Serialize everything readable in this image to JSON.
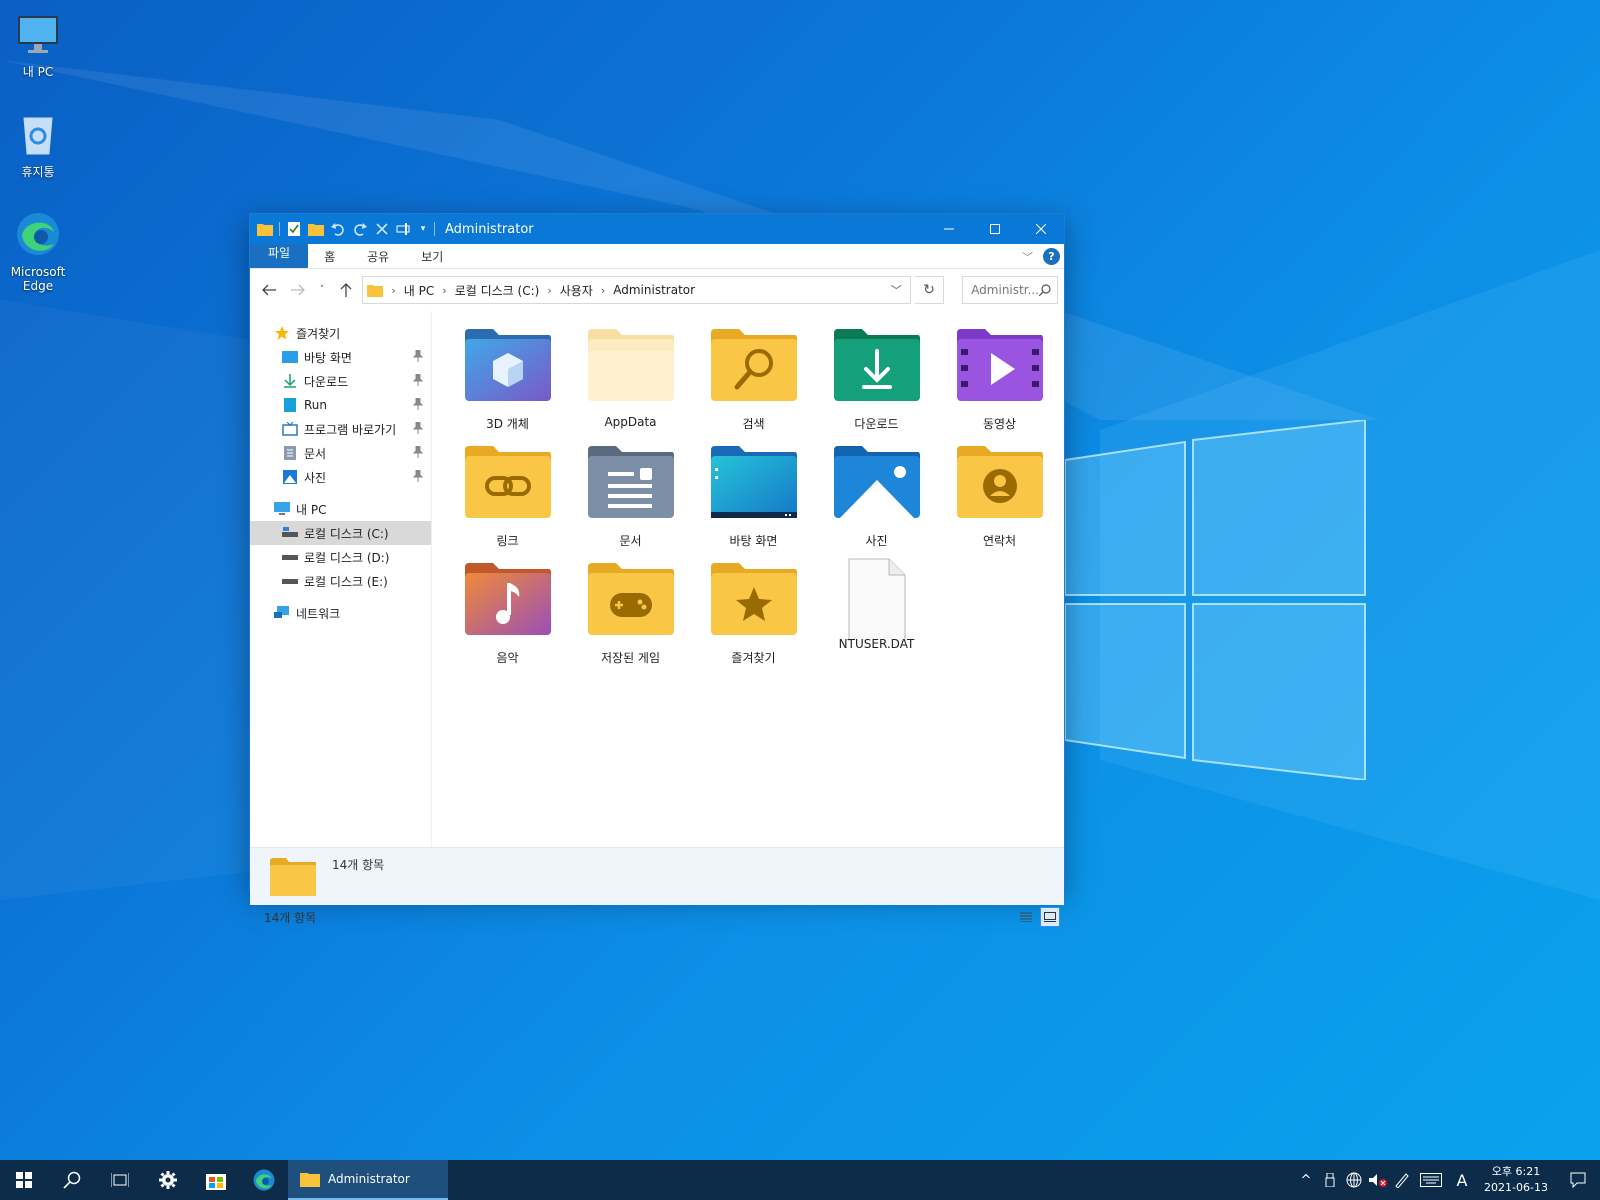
{
  "desktop": {
    "icons": [
      {
        "label": "내 PC",
        "icon": "computer-icon"
      },
      {
        "label": "휴지통",
        "icon": "recycle-bin-icon"
      },
      {
        "label": "Microsoft Edge",
        "icon": "edge-icon"
      }
    ]
  },
  "window": {
    "title": "Administrator",
    "ribbon_tabs": [
      "파일",
      "홈",
      "공유",
      "보기"
    ],
    "help_label": "?",
    "address": {
      "crumbs": [
        "내 PC",
        "로컬 디스크 (C:)",
        "사용자",
        "Administrator"
      ]
    },
    "search_placeholder": "Administr...",
    "nav": {
      "quick_access": "즐겨찾기",
      "pinned": [
        "바탕 화면",
        "다운로드",
        "Run",
        "프로그램 바로가기",
        "문서",
        "사진"
      ],
      "this_pc": "내 PC",
      "drives": [
        "로컬 디스크 (C:)",
        "로컬 디스크 (D:)",
        "로컬 디스크 (E:)"
      ],
      "selected_drive": "로컬 디스크 (C:)",
      "network": "네트워크"
    },
    "files": [
      {
        "label": "3D 개체",
        "icon": "3d-objects-folder-icon"
      },
      {
        "label": "AppData",
        "icon": "appdata-folder-icon"
      },
      {
        "label": "검색",
        "icon": "searches-folder-icon"
      },
      {
        "label": "다운로드",
        "icon": "downloads-folder-icon"
      },
      {
        "label": "동영상",
        "icon": "videos-folder-icon"
      },
      {
        "label": "링크",
        "icon": "links-folder-icon"
      },
      {
        "label": "문서",
        "icon": "documents-folder-icon"
      },
      {
        "label": "바탕 화면",
        "icon": "desktop-folder-icon"
      },
      {
        "label": "사진",
        "icon": "pictures-folder-icon"
      },
      {
        "label": "연락처",
        "icon": "contacts-folder-icon"
      },
      {
        "label": "음악",
        "icon": "music-folder-icon"
      },
      {
        "label": "저장된 게임",
        "icon": "saved-games-folder-icon"
      },
      {
        "label": "즐겨찾기",
        "icon": "favorites-folder-icon"
      },
      {
        "label": "NTUSER.DAT",
        "icon": "file-icon"
      }
    ],
    "details_text": "14개 항목",
    "status_text": "14개 항목"
  },
  "taskbar": {
    "active_app": "Administrator",
    "clock_time": "오후 6:21",
    "clock_date": "2021-06-13",
    "ime": "A"
  },
  "colors": {
    "titlebar": "#0a78d7",
    "taskbar": "#0d2c4a",
    "folder_yellow": "#f8c33b"
  }
}
